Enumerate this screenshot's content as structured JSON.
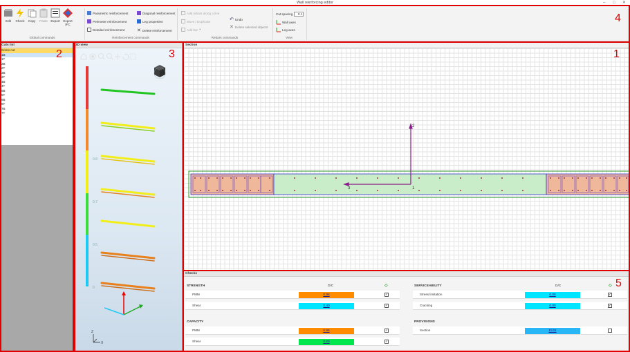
{
  "window": {
    "title": "Wall reinforcing editor",
    "minimize": "–",
    "maximize": "□",
    "close": "✕"
  },
  "ribbon": {
    "global": {
      "edit": "Edit",
      "check": "Check",
      "copy": "Copy",
      "paste": "Paste",
      "export": "Export",
      "export_ifc": "Export IFC",
      "label": "Global commands"
    },
    "reinforcement": {
      "parametric": "Parametric reinforcement",
      "diagonal": "Diagonal reinforcement",
      "perimeter": "Perimeter reinforcement",
      "leg_properties": "Leg properties",
      "detailed": "Detailed reinforcement",
      "delete": "Delete reinforcement",
      "label": "Reinforcement commands"
    },
    "rebars": {
      "add_along": "Add rebars along a line",
      "move_duplicate": "Move / Duplicate",
      "add_bar": "Add bar",
      "undo": "Undo",
      "delete_selected": "Delete selected objects",
      "label": "Rebars commands"
    },
    "view": {
      "cut_spacing_label": "Cut spacing",
      "cut_spacing_value": "0.1",
      "wall_axes": "Wall axes",
      "leg_axes": "Leg axes",
      "label": "View"
    }
  },
  "cuts": {
    "title": "Cuts list",
    "items": [
      "Some cut",
      "1B",
      "1T",
      "2B",
      "2T",
      "3B",
      "3T",
      "4B",
      "4T",
      "5B",
      "5T",
      "6B",
      "6T",
      "7B",
      "7T"
    ]
  },
  "view3d": {
    "title": "3D view",
    "levels": [
      "0.8",
      "0.7",
      "0.5",
      "0"
    ],
    "axis_z": "Z",
    "axis_x": "X"
  },
  "section": {
    "title": "Section",
    "nodes": [
      "1",
      "2",
      "3"
    ]
  },
  "checks": {
    "title": "Checks",
    "strength": {
      "head": "STRENGTH",
      "dc": "D/C",
      "rows": [
        {
          "label": "PMM",
          "value": "0.96",
          "color": "#ff8c00",
          "checked": true
        },
        {
          "label": "Shear",
          "value": "0.40",
          "color": "#00e5ff",
          "checked": true
        }
      ]
    },
    "capacity": {
      "head": "CAPACITY",
      "rows": [
        {
          "label": "PMM",
          "value": "0.96",
          "color": "#ff8c00",
          "checked": true
        },
        {
          "label": "Shear",
          "value": "0.60",
          "color": "#00e64d",
          "checked": true
        }
      ]
    },
    "serviceability": {
      "head": "SERVICEABILITY",
      "dc": "D/C",
      "rows": [
        {
          "label": "Stress limitation",
          "value": "0.06",
          "color": "#00e5ff",
          "checked": true
        },
        {
          "label": "Cracking",
          "value": "0.00",
          "color": "#00e5ff",
          "checked": true
        }
      ]
    },
    "provisions": {
      "head": "PROVISIONS",
      "rows": [
        {
          "label": "Section",
          "value": "11/11",
          "color": "#29b6f6",
          "checked": false
        }
      ]
    }
  },
  "annotations": [
    "1",
    "2",
    "3",
    "4",
    "5"
  ],
  "colors": {
    "annotation": "#e00000",
    "rebar_green": "#22c422",
    "rebar_yellow": "#f2ee1a",
    "rebar_orange": "#e8801c"
  }
}
